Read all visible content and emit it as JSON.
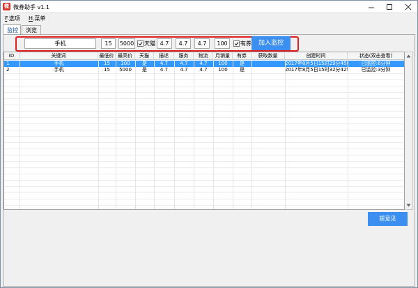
{
  "window": {
    "title": "微券助手 v1.1",
    "icon_glyph": "微"
  },
  "menu": {
    "items": [
      {
        "accel": "F",
        "label": ".选项"
      },
      {
        "accel": "H",
        "label": ".菜单"
      }
    ]
  },
  "tabs": [
    {
      "label": "监控",
      "active": true
    },
    {
      "label": "浏览",
      "active": false
    }
  ],
  "form": {
    "keyword": "手机",
    "min_price": "15",
    "max_price": "5000",
    "tmall_label": "天猫",
    "tmall_checked": true,
    "score_desc": "4.7",
    "score_service": "4.7",
    "score_logistics": "4.7",
    "monthly_sales": "100",
    "coupon_label": "有券",
    "coupon_checked": true,
    "add_button": "加入监控"
  },
  "table": {
    "columns": [
      "ID",
      "关键词",
      "最低价",
      "最高价",
      "天猫",
      "描述",
      "服务",
      "物流",
      "月销量",
      "有券",
      "获取数量",
      "创建时间",
      "状态(双击查看)"
    ],
    "rows": [
      [
        "1",
        "手机",
        "15",
        "100",
        "是",
        "4.7",
        "4.7",
        "4.7",
        "100",
        "是",
        "",
        "2017年8月5日15时29分45秒",
        "已监控:6分钟"
      ],
      [
        "2",
        "手机",
        "15",
        "5000",
        "是",
        "4.7",
        "4.7",
        "4.7",
        "100",
        "是",
        "",
        "2017年8月5日15时32分42秒",
        "已监控:3分钟"
      ]
    ],
    "selected_row": 0
  },
  "feedback_button": "提意见",
  "colors": {
    "accent_button": "#3a8ff0",
    "selected_row": "#3399ff",
    "highlight_border": "#e02020"
  }
}
